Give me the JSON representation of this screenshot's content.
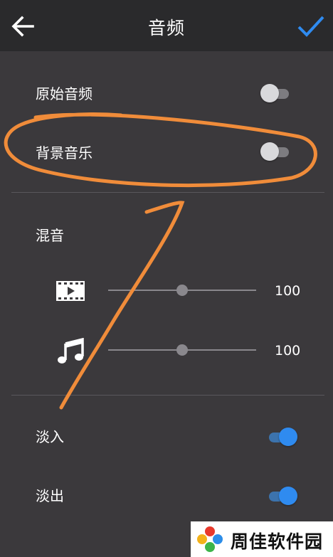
{
  "header": {
    "title": "音频",
    "back_icon": "arrow-left-icon",
    "confirm_icon": "checkmark-icon"
  },
  "colors": {
    "accent": "#2f8bf0",
    "annotation": "#f08c3a",
    "background": "#3b393c",
    "header": "#2a2a2c"
  },
  "settings": {
    "original_audio": {
      "label": "原始音频",
      "enabled": false
    },
    "background_music": {
      "label": "背景音乐",
      "enabled": false
    }
  },
  "mix": {
    "heading": "混音",
    "video": {
      "icon": "video-icon",
      "value": "100",
      "level": 0.5
    },
    "music": {
      "icon": "music-note-icon",
      "value": "100",
      "level": 0.5
    }
  },
  "fade": {
    "fade_in": {
      "label": "淡入",
      "enabled": true
    },
    "fade_out": {
      "label": "淡出",
      "enabled": true
    }
  },
  "watermark": {
    "text": "周佳软件园"
  }
}
